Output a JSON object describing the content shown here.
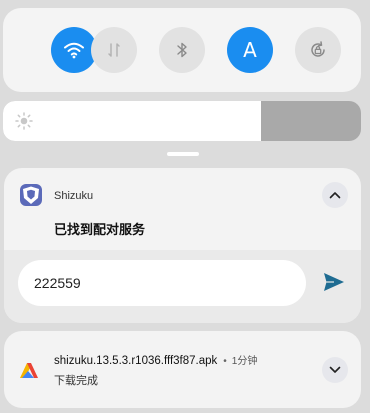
{
  "quick_settings": {
    "tiles": [
      {
        "icon": "wifi-icon",
        "state": "on"
      },
      {
        "icon": "mobile-data-icon",
        "state": "off"
      },
      {
        "icon": "bluetooth-icon",
        "state": "off"
      },
      {
        "icon": "auto-brightness-icon",
        "label": "A",
        "state": "on"
      },
      {
        "icon": "auto-rotate-icon",
        "state": "off"
      }
    ],
    "accent_color": "#1a8df0"
  },
  "brightness": {
    "level_percent": 72,
    "icon": "sun-icon"
  },
  "notifications": [
    {
      "app_name": "Shizuku",
      "app_icon": "shizuku-app-icon",
      "title": "已找到配对服务",
      "reply": {
        "value": "222559"
      },
      "collapse_icon": "chevron-up-icon",
      "send_icon": "send-icon",
      "send_color": "#1f6c92"
    },
    {
      "app_icon": "download-app-icon",
      "title": "shizuku.13.5.3.r1036.fff3f87.apk",
      "separator": "•",
      "time": "1分钟",
      "status": "下载完成",
      "expand_icon": "chevron-down-icon"
    }
  ]
}
